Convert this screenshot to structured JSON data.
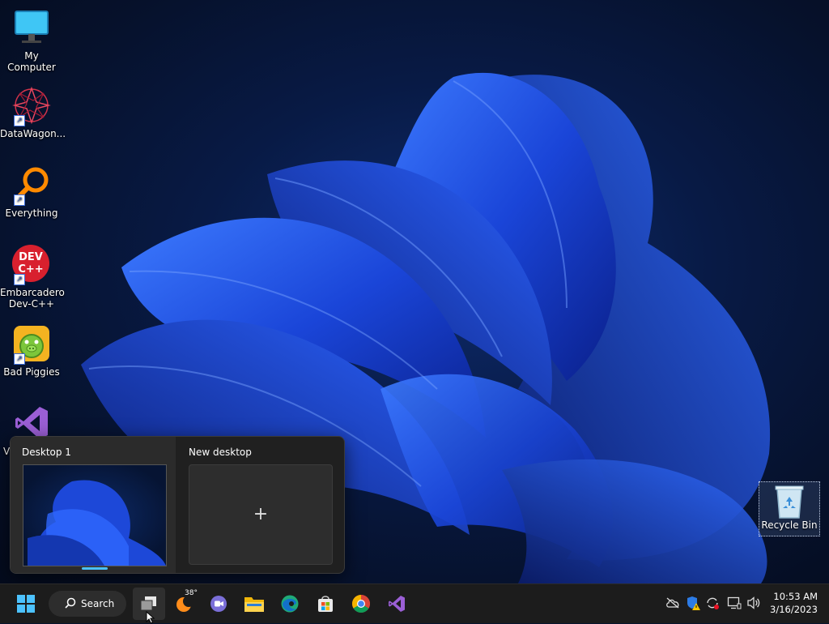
{
  "desktop_icons": [
    {
      "name": "my-computer",
      "label": "My Computer",
      "shortcut": false
    },
    {
      "name": "datawagon",
      "label": "DataWagon...",
      "shortcut": true
    },
    {
      "name": "everything",
      "label": "Everything",
      "shortcut": true
    },
    {
      "name": "dev-cpp",
      "label": "Embarcadero Dev-C++",
      "shortcut": true,
      "logo_text": "DEV C++"
    },
    {
      "name": "bad-piggies",
      "label": "Bad Piggies",
      "shortcut": true
    },
    {
      "name": "visual-studio",
      "label": "V",
      "shortcut": true
    }
  ],
  "recycle_bin": {
    "label": "Recycle Bin"
  },
  "task_view": {
    "desktops": [
      {
        "label": "Desktop 1",
        "selected": true
      },
      {
        "label": "New desktop",
        "action_glyph": "+"
      }
    ]
  },
  "taskbar": {
    "search_label": "Search",
    "weather_temp": "38°",
    "pinned": [
      "start-icon",
      "task-view-icon",
      "weather-icon",
      "teams-chat-icon",
      "file-explorer-icon",
      "edge-icon",
      "store-icon",
      "chrome-icon",
      "visual-studio-icon"
    ],
    "tray": [
      "onedrive-offline-icon",
      "defender-warning-icon",
      "sync-icon",
      "network-icon",
      "volume-icon"
    ],
    "clock": {
      "time": "10:53 AM",
      "date": "3/16/2023"
    }
  },
  "colors": {
    "accent": "#4cc2ff",
    "taskbar": "#1c1c1c",
    "flyout": "#202020",
    "bloom": "#1f4fe0"
  }
}
